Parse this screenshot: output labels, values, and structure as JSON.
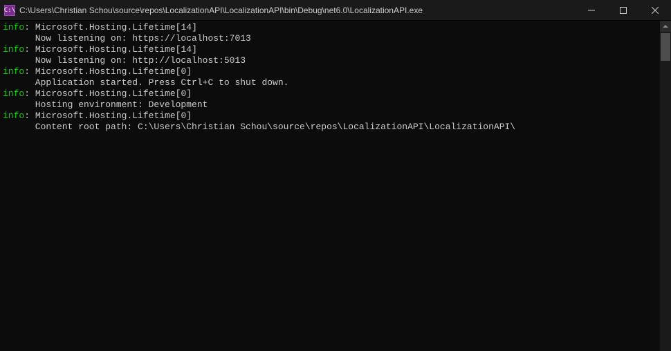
{
  "window": {
    "title": "C:\\Users\\Christian Schou\\source\\repos\\LocalizationAPI\\LocalizationAPI\\bin\\Debug\\net6.0\\LocalizationAPI.exe",
    "app_icon_text": "C:\\"
  },
  "log": {
    "lines": [
      {
        "level": "info",
        "source": "Microsoft.Hosting.Lifetime[14]",
        "message": "Now listening on: https://localhost:7013"
      },
      {
        "level": "info",
        "source": "Microsoft.Hosting.Lifetime[14]",
        "message": "Now listening on: http://localhost:5013"
      },
      {
        "level": "info",
        "source": "Microsoft.Hosting.Lifetime[0]",
        "message": "Application started. Press Ctrl+C to shut down."
      },
      {
        "level": "info",
        "source": "Microsoft.Hosting.Lifetime[0]",
        "message": "Hosting environment: Development"
      },
      {
        "level": "info",
        "source": "Microsoft.Hosting.Lifetime[0]",
        "message": "Content root path: C:\\Users\\Christian Schou\\source\\repos\\LocalizationAPI\\LocalizationAPI\\"
      }
    ]
  }
}
